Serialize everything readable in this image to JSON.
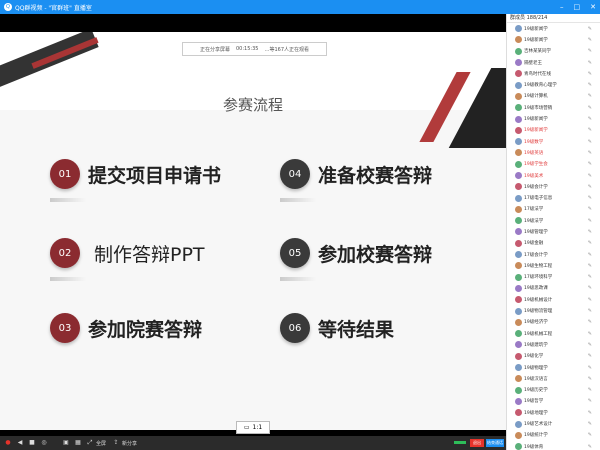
{
  "titlebar": {
    "title": "QQ群视频 - \"官群班\" 直播室",
    "controls": [
      "–",
      "□",
      "✕"
    ]
  },
  "share_bar": {
    "status": "正在分享屏幕",
    "time": "00:15:35",
    "notice": "…等167人正在观看"
  },
  "slide": {
    "title": "参赛流程",
    "steps": [
      {
        "num": "01",
        "label": "提交项目申请书"
      },
      {
        "num": "02",
        "label": "制作答辩PPT"
      },
      {
        "num": "03",
        "label": "参加院赛答辩"
      },
      {
        "num": "04",
        "label": "准备校赛答辩"
      },
      {
        "num": "05",
        "label": "参加校赛答辩"
      },
      {
        "num": "06",
        "label": "等待结果"
      }
    ],
    "colors": {
      "red": "#8b2b30",
      "dark": "#3a3a3a"
    }
  },
  "page_indicator": "1:1",
  "toolbar": {
    "fullscreen": "全屏",
    "split": "新分享",
    "end_label": "退出",
    "view_label": "结束通话"
  },
  "members": {
    "header": "群成员 188/214",
    "list": [
      "19级新闻学",
      "19级新闻学",
      "吉林某某同学",
      "隔壁老王",
      "青鸟时代在线",
      "19级教育心理学",
      "19级计算机",
      "19级市场营销",
      "19级新闻学",
      "19级新闻学",
      "19级数学",
      "19级英语",
      "19级学生会",
      "19级美术",
      "19级会计学",
      "17级电子信息",
      "17级法学",
      "19级法学",
      "19级管理学",
      "19级金融",
      "17级会计学",
      "19级生物工程",
      "17级环境科学",
      "19级思政课",
      "19级机械设计",
      "19级物流管理",
      "19级经济学",
      "19级机械工程",
      "19级建筑学",
      "19级化学",
      "19级物理学",
      "19级汉语言",
      "19级历史学",
      "19级哲学",
      "19级地理学",
      "19级艺术设计",
      "19级统计学",
      "19级体育",
      "19级音乐"
    ]
  }
}
